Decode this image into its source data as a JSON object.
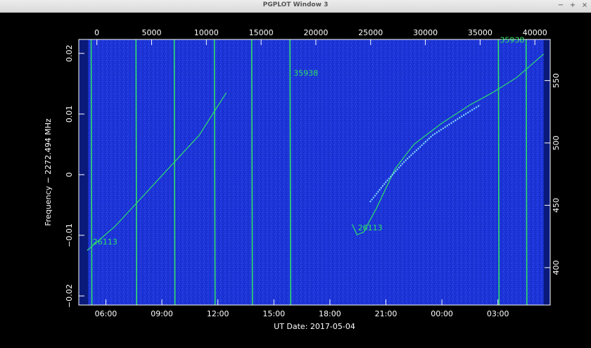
{
  "window": {
    "title": "PGPLOT Window 3",
    "buttons": {
      "minimize": "−",
      "maximize": "+",
      "close": "×"
    }
  },
  "chart_data": {
    "type": "scatter",
    "background_color": "#1c34d8",
    "curve_color": "#2ee06a",
    "label_color": "#2ee06a",
    "axis_color": "#ffffff",
    "xlabel": "UT Date: 2017-05-04",
    "ylabel": "Frequency − 2272.494 MHz",
    "bottom_axis": {
      "range_hours": [
        4.55,
        29.8
      ],
      "ticks": [
        {
          "value": 6,
          "label": "06:00"
        },
        {
          "value": 9,
          "label": "09:00"
        },
        {
          "value": 12,
          "label": "12:00"
        },
        {
          "value": 15,
          "label": "15:00"
        },
        {
          "value": 18,
          "label": "18:00"
        },
        {
          "value": 21,
          "label": "21:00"
        },
        {
          "value": 24,
          "label": "00:00"
        },
        {
          "value": 27,
          "label": "03:00"
        }
      ]
    },
    "top_axis": {
      "range": [
        -1650,
        41400
      ],
      "ticks": [
        0,
        5000,
        10000,
        15000,
        20000,
        25000,
        30000,
        35000,
        40000
      ]
    },
    "left_axis": {
      "range": [
        -0.0215,
        0.0223
      ],
      "ticks": [
        {
          "value": -0.02,
          "label": "−0.02"
        },
        {
          "value": -0.01,
          "label": "−0.01"
        },
        {
          "value": 0,
          "label": "0"
        },
        {
          "value": 0.01,
          "label": "0.01"
        },
        {
          "value": 0.02,
          "label": "0.02"
        }
      ]
    },
    "right_axis": {
      "range": [
        370,
        583
      ],
      "ticks": [
        400,
        450,
        500,
        550
      ]
    },
    "vertical_tracks_hours": [
      5.25,
      7.65,
      9.7,
      11.85,
      13.85,
      15.9,
      27.06,
      28.55
    ],
    "pass_curves": [
      {
        "label": "26113",
        "points": [
          [
            5.0,
            -0.0125
          ],
          [
            6.5,
            -0.0085
          ],
          [
            8.0,
            -0.0035
          ],
          [
            9.5,
            0.0015
          ],
          [
            11.0,
            0.0065
          ],
          [
            12.45,
            0.0135
          ]
        ]
      },
      {
        "label": "26113",
        "points": [
          [
            19.2,
            -0.0082
          ],
          [
            19.45,
            -0.0099
          ],
          [
            19.8,
            -0.0095
          ],
          [
            20.5,
            -0.0055
          ],
          [
            21.5,
            0.001
          ],
          [
            22.5,
            0.005
          ],
          [
            24.0,
            0.0085
          ],
          [
            25.5,
            0.0115
          ],
          [
            26.7,
            0.0135
          ],
          [
            28.0,
            0.016
          ],
          [
            29.45,
            0.0199
          ]
        ]
      }
    ],
    "dashed_track": {
      "points": [
        [
          20.15,
          -0.0045
        ],
        [
          21.0,
          -0.0012
        ],
        [
          22.0,
          0.0022
        ],
        [
          23.5,
          0.0065
        ],
        [
          25.0,
          0.0095
        ],
        [
          26.05,
          0.0115
        ]
      ]
    },
    "annotations": [
      {
        "text": "26113",
        "x_hours": 5.3,
        "y": -0.0115
      },
      {
        "text": "35938",
        "x_hours": 16.05,
        "y": 0.0163
      },
      {
        "text": "26113",
        "x_hours": 19.5,
        "y": -0.0092
      },
      {
        "text": "35938",
        "x_hours": 27.1,
        "y": 0.0218
      }
    ]
  }
}
